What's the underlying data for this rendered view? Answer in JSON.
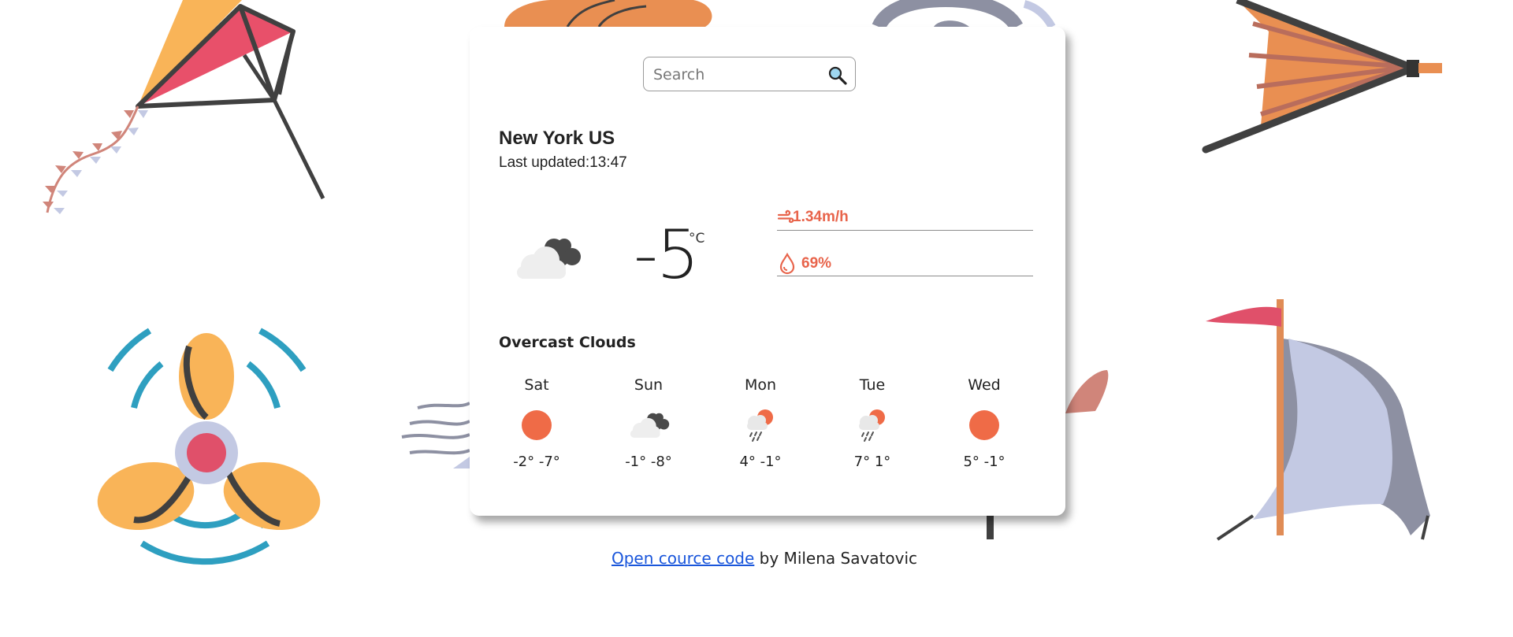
{
  "search": {
    "placeholder": "Search"
  },
  "location": {
    "city": "New York US",
    "last_updated": "Last updated:13:47"
  },
  "current": {
    "temperature": "-5",
    "unit": "°C",
    "icon": "cloud-icon",
    "wind": "1.34m/h",
    "humidity": "69%",
    "description": "Overcast Clouds"
  },
  "forecast": [
    {
      "day": "Sat",
      "icon": "sun-icon",
      "temps": "-2° -7°"
    },
    {
      "day": "Sun",
      "icon": "cloud-icon",
      "temps": "-1° -8°"
    },
    {
      "day": "Mon",
      "icon": "rain-sun-icon",
      "temps": "4° -1°"
    },
    {
      "day": "Tue",
      "icon": "rain-sun-icon",
      "temps": "7° 1°"
    },
    {
      "day": "Wed",
      "icon": "sun-icon",
      "temps": "5° -1°"
    }
  ],
  "footer": {
    "link_text": "Open cource code",
    "suffix": " by Milena Savatovic"
  },
  "colors": {
    "accent": "#e8644b",
    "sun": "#ef6b47",
    "link": "#1a56db"
  }
}
